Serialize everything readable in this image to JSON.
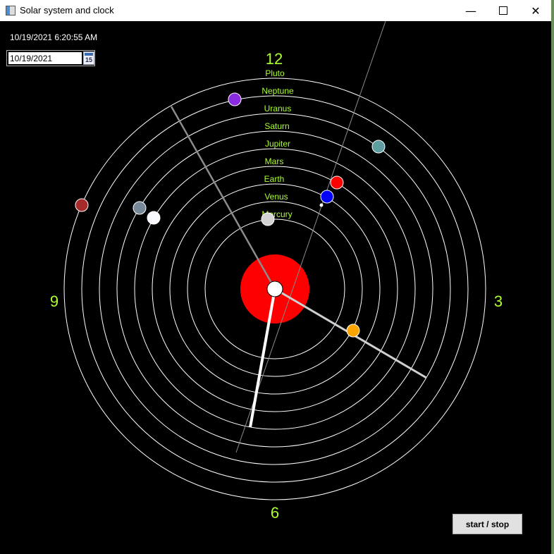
{
  "window": {
    "title": "Solar system and clock",
    "minimize_symbol": "—",
    "close_symbol": "✕"
  },
  "datetime_display": "10/19/2021 6:20:55 AM",
  "date_picker": {
    "value": "10/19/2021",
    "calendar_day": "15"
  },
  "clock_numbers": {
    "twelve": "12",
    "three": "3",
    "six": "6",
    "nine": "9"
  },
  "orbit_labels": [
    "Pluto",
    "Neptune",
    "Uranus",
    "Saturn",
    "Jupiter",
    "Mars",
    "Earth",
    "Venus",
    "Mercury"
  ],
  "planets": [
    {
      "name": "mercury",
      "color": "#d3d3d3"
    },
    {
      "name": "venus",
      "color": "#ffa500"
    },
    {
      "name": "earth",
      "color": "#0000ff"
    },
    {
      "name": "mars",
      "color": "#ff0000"
    },
    {
      "name": "jupiter",
      "color": "#f8f8ff"
    },
    {
      "name": "saturn",
      "color": "#778899"
    },
    {
      "name": "uranus",
      "color": "#5f9ea0"
    },
    {
      "name": "neptune",
      "color": "#8a2be2"
    },
    {
      "name": "pluto",
      "color": "#a52a2a"
    }
  ],
  "colors": {
    "sun": "#ff0000",
    "labels": "#adff2f",
    "orbits": "#ffffff"
  },
  "start_stop_label": "start / stop"
}
